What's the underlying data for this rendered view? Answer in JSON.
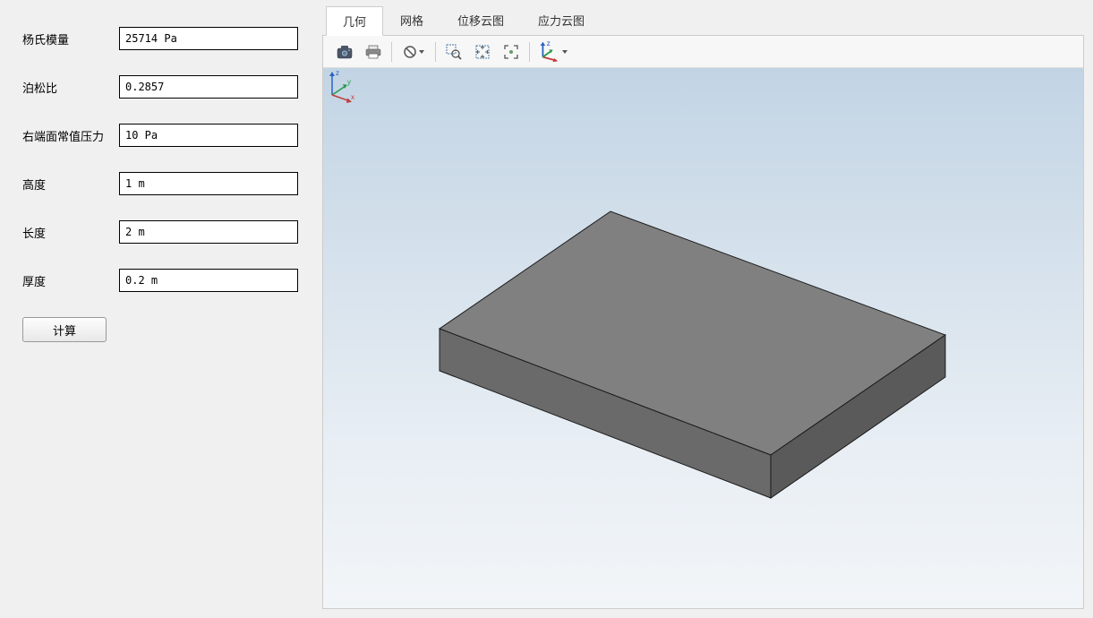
{
  "sidebar": {
    "fields": [
      {
        "label": "杨氏模量",
        "value": "25714 Pa"
      },
      {
        "label": "泊松比",
        "value": "0.2857"
      },
      {
        "label": "右端面常值压力",
        "value": "10 Pa"
      },
      {
        "label": "高度",
        "value": "1 m"
      },
      {
        "label": "长度",
        "value": "2 m"
      },
      {
        "label": "厚度",
        "value": "0.2 m"
      }
    ],
    "compute_label": "计算"
  },
  "tabs": [
    {
      "label": "几何",
      "active": true
    },
    {
      "label": "网格",
      "active": false
    },
    {
      "label": "位移云图",
      "active": false
    },
    {
      "label": "应力云图",
      "active": false
    }
  ],
  "toolbar": {
    "icons": [
      "camera-icon",
      "print-icon",
      "sep",
      "reset-icon",
      "sep",
      "zoom-box-icon",
      "zoom-extents-icon",
      "zoom-selection-icon",
      "sep",
      "axis-triad-icon"
    ]
  },
  "triad": {
    "axes": [
      "x",
      "y",
      "z"
    ]
  }
}
